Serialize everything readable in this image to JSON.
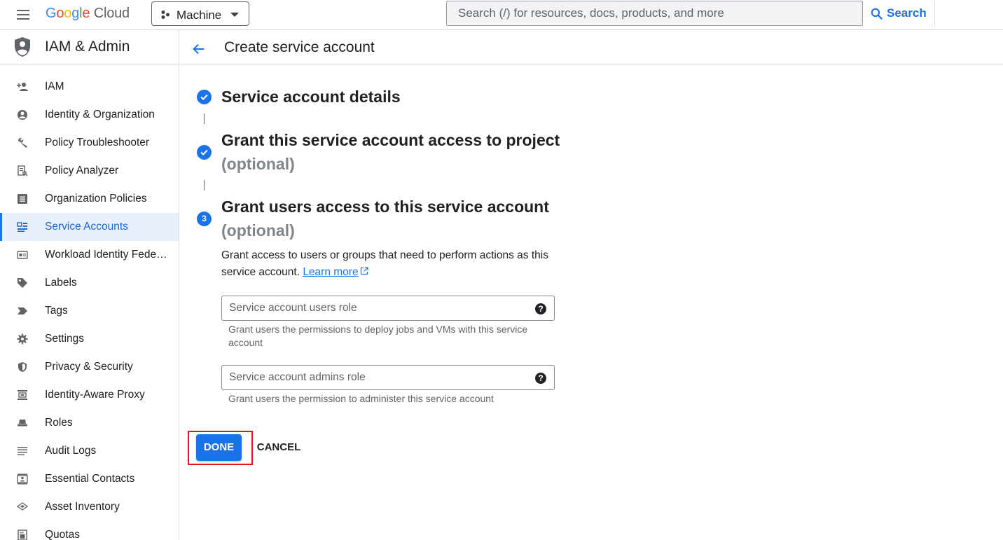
{
  "topbar": {
    "logo_parts": [
      "G",
      "o",
      "o",
      "g",
      "l",
      "e",
      "Cloud"
    ],
    "project": "Machine",
    "search_placeholder": "Search (/) for resources, docs, products, and more",
    "search_button": "Search"
  },
  "sidebar": {
    "title": "IAM & Admin",
    "items": [
      {
        "label": "IAM",
        "icon": "person-add-icon"
      },
      {
        "label": "Identity & Organization",
        "icon": "account-circle-icon"
      },
      {
        "label": "Policy Troubleshooter",
        "icon": "wrench-icon"
      },
      {
        "label": "Policy Analyzer",
        "icon": "document-search-icon"
      },
      {
        "label": "Organization Policies",
        "icon": "list-alt-icon"
      },
      {
        "label": "Service Accounts",
        "icon": "service-account-icon",
        "active": true
      },
      {
        "label": "Workload Identity Feder…",
        "icon": "id-card-icon"
      },
      {
        "label": "Labels",
        "icon": "label-icon"
      },
      {
        "label": "Tags",
        "icon": "tag-chevron-icon"
      },
      {
        "label": "Settings",
        "icon": "gear-icon"
      },
      {
        "label": "Privacy & Security",
        "icon": "shield-icon"
      },
      {
        "label": "Identity-Aware Proxy",
        "icon": "proxy-icon"
      },
      {
        "label": "Roles",
        "icon": "hat-icon"
      },
      {
        "label": "Audit Logs",
        "icon": "lines-icon"
      },
      {
        "label": "Essential Contacts",
        "icon": "contact-icon"
      },
      {
        "label": "Asset Inventory",
        "icon": "layers-icon"
      },
      {
        "label": "Quotas",
        "icon": "quota-icon"
      }
    ]
  },
  "page": {
    "title": "Create service account",
    "steps": [
      {
        "title": "Service account details",
        "optional": "",
        "state": "done"
      },
      {
        "title": "Grant this service account access to project",
        "optional": "(optional)",
        "state": "done"
      },
      {
        "title": "Grant users access to this service account",
        "optional": "(optional)",
        "state": "current",
        "number": "3"
      }
    ],
    "description": "Grant access to users or groups that need to perform actions as this service account.",
    "learn_more": "Learn more",
    "fields": [
      {
        "placeholder": "Service account users role",
        "hint": "Grant users the permissions to deploy jobs and VMs with this service account"
      },
      {
        "placeholder": "Service account admins role",
        "hint": "Grant users the permission to administer this service account"
      }
    ],
    "help_glyph": "?",
    "done_label": "DONE",
    "cancel_label": "CANCEL"
  },
  "colors": {
    "accent": "#1a73e8",
    "highlight_outline": "#e8141c",
    "active_nav_bg": "#e8f0fe"
  }
}
